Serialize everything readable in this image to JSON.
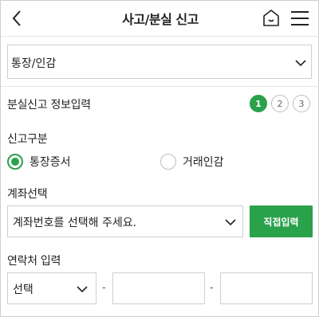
{
  "header": {
    "title": "사고/분실 신고",
    "back_icon": "chevron-left-icon",
    "home_icon": "home-icon",
    "menu_icon": "hamburger-menu-icon"
  },
  "product_select": {
    "value": "통장/인감"
  },
  "loss_info": {
    "title": "분실신고 정보입력",
    "steps": [
      "1",
      "2",
      "3"
    ],
    "active_step": 1
  },
  "report_type": {
    "label": "신고구분",
    "options": [
      {
        "label": "통장증서",
        "checked": true
      },
      {
        "label": "거래인감",
        "checked": false
      }
    ]
  },
  "account": {
    "label": "계좌선택",
    "placeholder": "계좌번호를 선택해 주세요.",
    "direct_button": "직접입력"
  },
  "contact": {
    "label": "연락처 입력",
    "select_value": "선택",
    "separator": "-"
  },
  "colors": {
    "accent": "#2aa14b",
    "border": "#cfcfcf",
    "text": "#222222"
  }
}
